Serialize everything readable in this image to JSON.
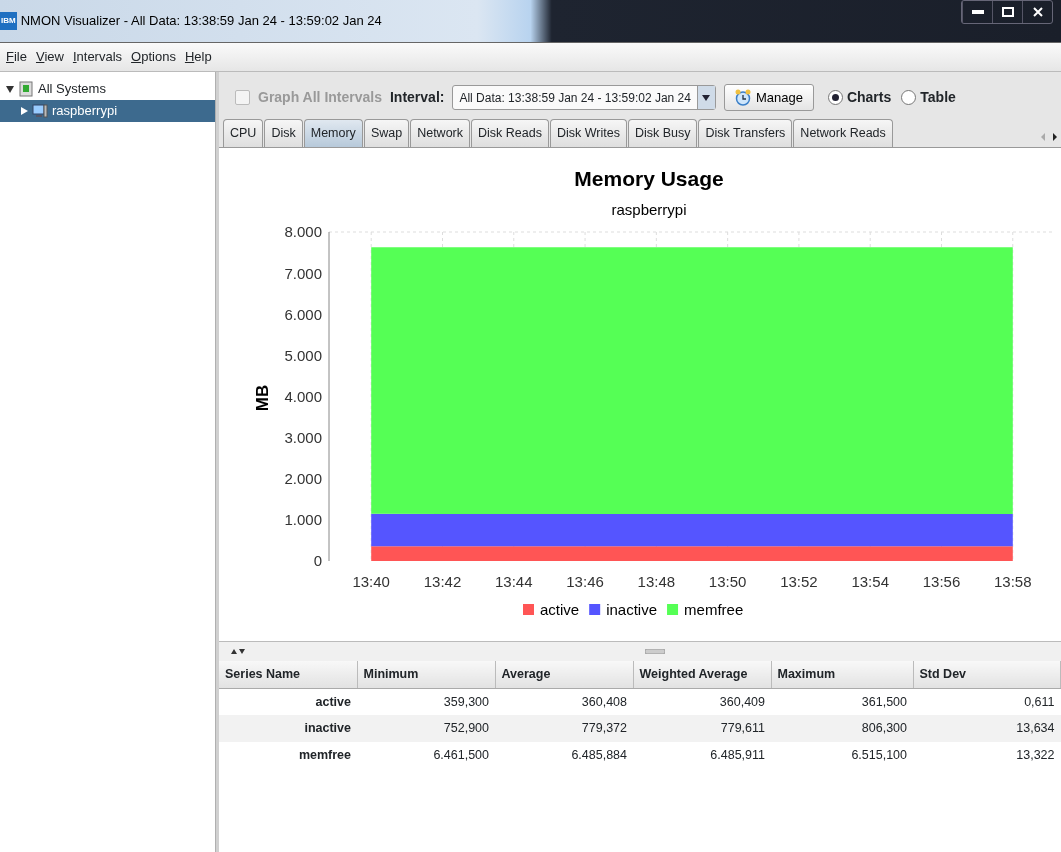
{
  "window": {
    "logo": "IBM",
    "title": "NMON Visualizer - All Data: 13:38:59 Jan 24 - 13:59:02 Jan 24"
  },
  "menu": [
    "File",
    "View",
    "Intervals",
    "Options",
    "Help"
  ],
  "tree": [
    {
      "label": "All Systems",
      "expanded": true,
      "selected": false,
      "children": [
        {
          "label": "raspberrypi",
          "expanded": false,
          "selected": true
        }
      ]
    }
  ],
  "toolbar": {
    "graph_all": {
      "label": "Graph All Intervals",
      "checked": false,
      "disabled": true
    },
    "interval_label": "Interval:",
    "interval_value": "All Data: 13:38:59 Jan 24 - 13:59:02 Jan 24",
    "manage_button": "Manage",
    "views": [
      {
        "label": "Charts",
        "selected": true
      },
      {
        "label": "Table",
        "selected": false
      }
    ]
  },
  "tabs": [
    {
      "label": "CPU",
      "selected": false
    },
    {
      "label": "Disk",
      "selected": false
    },
    {
      "label": "Memory",
      "selected": true
    },
    {
      "label": "Swap",
      "selected": false
    },
    {
      "label": "Network",
      "selected": false
    },
    {
      "label": "Disk Reads",
      "selected": false
    },
    {
      "label": "Disk Writes",
      "selected": false
    },
    {
      "label": "Disk Busy",
      "selected": false
    },
    {
      "label": "Disk Transfers",
      "selected": false
    },
    {
      "label": "Network Reads",
      "selected": false
    }
  ],
  "chart": {
    "chart_data": {
      "type": "area",
      "title": "Memory Usage",
      "subtitle": "raspberrypi",
      "ylabel": "MB",
      "stacked": true,
      "categories": [
        "13:40",
        "13:42",
        "13:44",
        "13:46",
        "13:48",
        "13:50",
        "13:52",
        "13:54",
        "13:56",
        "13:58"
      ],
      "series": [
        {
          "name": "active",
          "color": "#ff5555",
          "values": [
            360,
            360,
            360,
            360,
            360,
            360,
            360,
            360,
            360,
            360
          ]
        },
        {
          "name": "inactive",
          "color": "#5555ff",
          "values": [
            790,
            780,
            780,
            780,
            780,
            780,
            780,
            780,
            780,
            780
          ]
        },
        {
          "name": "memfree",
          "color": "#55ff55",
          "values": [
            6480,
            6490,
            6490,
            6490,
            6490,
            6490,
            6490,
            6490,
            6490,
            6490
          ]
        }
      ],
      "ylim": [
        0,
        8000
      ],
      "grid": true,
      "legend": "bottom",
      "yticks": [
        {
          "value": 0,
          "label": "0"
        },
        {
          "value": 1000,
          "label": "1.000"
        },
        {
          "value": 2000,
          "label": "2.000"
        },
        {
          "value": 3000,
          "label": "3.000"
        },
        {
          "value": 4000,
          "label": "4.000"
        },
        {
          "value": 5000,
          "label": "5.000"
        },
        {
          "value": 6000,
          "label": "6.000"
        },
        {
          "value": 7000,
          "label": "7.000"
        },
        {
          "value": 8000,
          "label": "8.000"
        }
      ]
    }
  },
  "stats_table": {
    "columns": [
      "Series Name",
      "Minimum",
      "Average",
      "Weighted Average",
      "Maximum",
      "Std Dev"
    ],
    "rows": [
      [
        "active",
        "359,300",
        "360,408",
        "360,409",
        "361,500",
        "0,611"
      ],
      [
        "inactive",
        "752,900",
        "779,372",
        "779,611",
        "806,300",
        "13,634"
      ],
      [
        "memfree",
        "6.461,500",
        "6.485,884",
        "6.485,911",
        "6.515,100",
        "13,322"
      ]
    ]
  }
}
